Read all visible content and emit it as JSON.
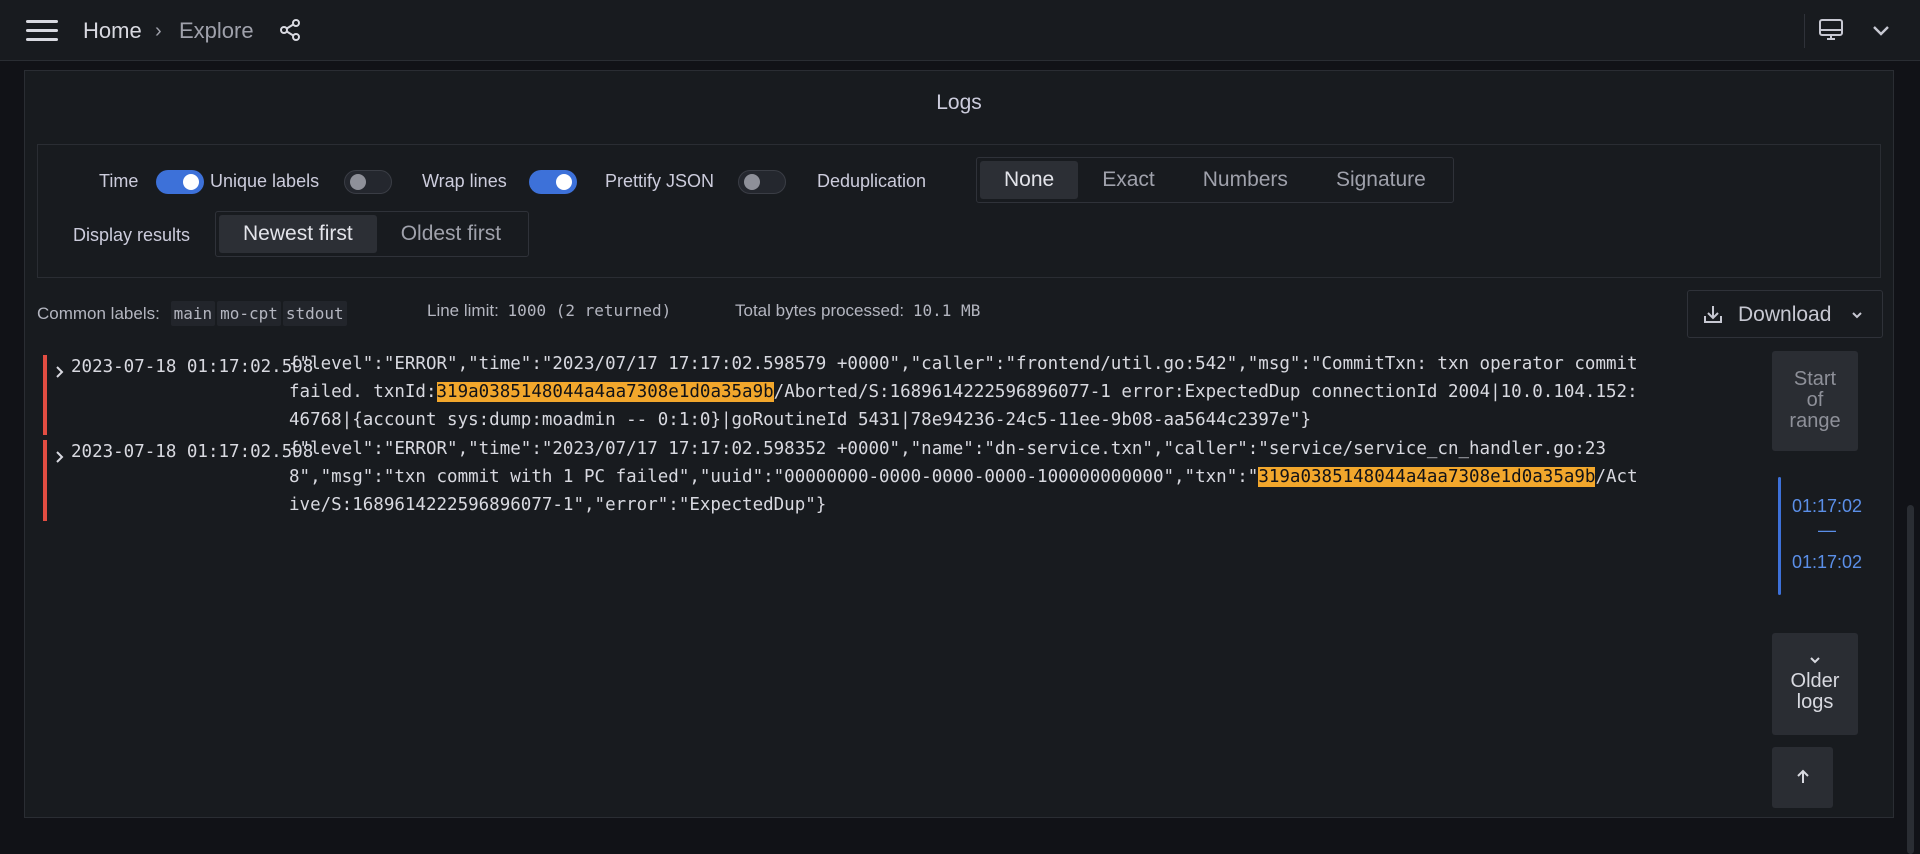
{
  "nav": {
    "home": "Home",
    "separator": "›",
    "explore": "Explore"
  },
  "panel": {
    "title": "Logs"
  },
  "options": {
    "time_label": "Time",
    "time_on": true,
    "unique_labels_label": "Unique labels",
    "unique_labels_on": false,
    "wrap_lines_label": "Wrap lines",
    "wrap_lines_on": true,
    "prettify_json_label": "Prettify JSON",
    "prettify_json_on": false,
    "dedup_label": "Deduplication",
    "dedup_options": [
      "None",
      "Exact",
      "Numbers",
      "Signature"
    ],
    "dedup_selected": "None",
    "display_results_label": "Display results",
    "display_options": [
      "Newest first",
      "Oldest first"
    ],
    "display_selected": "Newest first"
  },
  "meta": {
    "common_labels_label": "Common labels:",
    "common_labels": [
      "main",
      "mo-cpt",
      "stdout"
    ],
    "line_limit_label": "Line limit:",
    "line_limit_value": "1000 (2 returned)",
    "bytes_label": "Total bytes processed:",
    "bytes_value": "10.1 MB",
    "download_label": "Download"
  },
  "logs": [
    {
      "timestamp": "2023-07-18 01:17:02.598",
      "line1": "{\"level\":\"ERROR\",\"time\":\"2023/07/17 17:17:02.598579 +0000\",\"caller\":\"frontend/util.go:542\",\"msg\":\"CommitTxn: txn operator commit",
      "line2_pre": "failed. txnId:",
      "line2_hl": "319a0385148044a4aa7308e1d0a35a9b",
      "line2_post": "/Aborted/S:1689614222596896077-1 error:ExpectedDup connectionId 2004|10.0.104.152:",
      "line3": "46768|{account sys:dump:moadmin -- 0:1:0}|goRoutineId 5431|78e94236-24c5-11ee-9b08-aa5644c2397e\"}"
    },
    {
      "timestamp": "2023-07-18 01:17:02.598",
      "line1": "{\"level\":\"ERROR\",\"time\":\"2023/07/17 17:17:02.598352 +0000\",\"name\":\"dn-service.txn\",\"caller\":\"service/service_cn_handler.go:23",
      "line2_pre": "8\",\"msg\":\"txn commit with 1 PC failed\",\"uuid\":\"00000000-0000-0000-0000-100000000000\",\"txn\":\"",
      "line2_hl": "319a0385148044a4aa7308e1d0a35a9b",
      "line2_post": "/Act",
      "line3": "ive/S:1689614222596896077-1\",\"error\":\"ExpectedDup\"}"
    }
  ],
  "side": {
    "start_line1": "Start",
    "start_line2": "of",
    "start_line3": "range",
    "range_start": "01:17:02",
    "range_dash": "—",
    "range_end": "01:17:02",
    "older_line1": "Older",
    "older_line2": "logs"
  },
  "colors": {
    "accent": "#3d71d9",
    "error_bar": "#e24d42",
    "highlight": "#f2a72c"
  }
}
